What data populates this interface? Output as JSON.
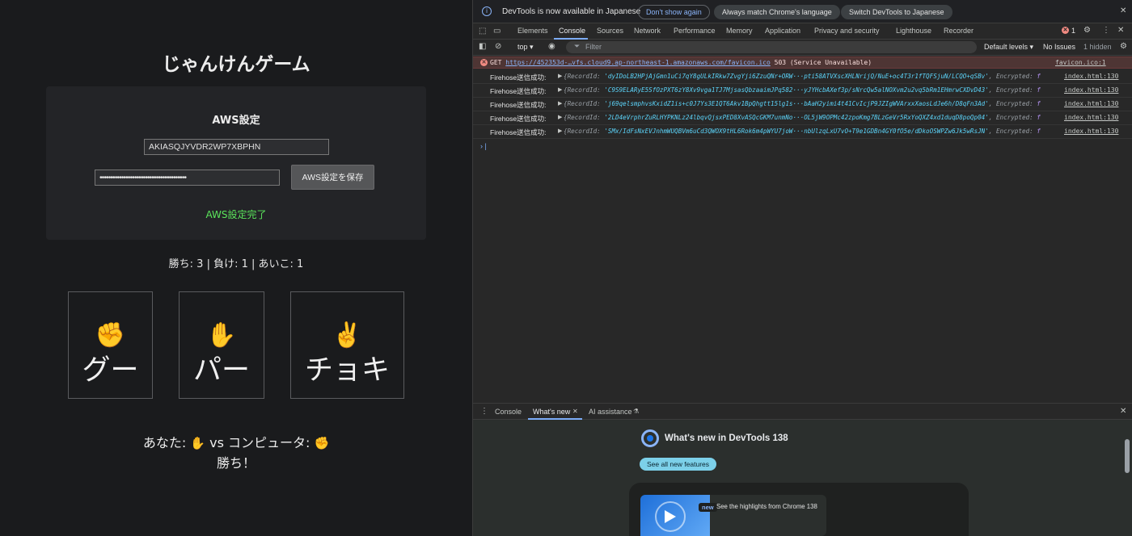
{
  "game": {
    "title": "じゃんけんゲーム",
    "aws_section_title": "AWS設定",
    "access_key_value": "AKIASQJYVDR2WP7XBPHN",
    "secret_key_masked": "••••••••••••••••••••••••••••••••••••••••",
    "save_button": "AWS設定を保存",
    "status_message": "AWS設定完了",
    "score": "勝ち: 3 | 負け: 1 | あいこ: 1",
    "choices": [
      {
        "emoji": "✊",
        "label": "グー"
      },
      {
        "emoji": "✋",
        "label": "パー"
      },
      {
        "emoji": "✌️",
        "label": "チョキ"
      }
    ],
    "result_prefix": "あなた:",
    "result_you_emoji": "✋",
    "result_vs": "vs コンピュータ:",
    "result_cpu_emoji": "✊",
    "result_outcome": "勝ち！"
  },
  "devtools": {
    "infobar": {
      "text": "DevTools is now available in Japanese",
      "btn_dont_show": "Don't show again",
      "btn_match": "Always match Chrome's language",
      "btn_switch": "Switch DevTools to Japanese"
    },
    "tabs": [
      "Elements",
      "Console",
      "Sources",
      "Network",
      "Performance",
      "Memory",
      "Application",
      "Privacy and security",
      "Lighthouse",
      "Recorder"
    ],
    "error_count": "1",
    "toolbar": {
      "context": "top ▾",
      "filter_placeholder": "Filter",
      "levels": "Default levels ▾",
      "issues": "No Issues",
      "hidden": "1 hidden"
    },
    "error_line": {
      "method": "GET",
      "url": "https://452353d-…vfs.cloud9.ap-northeast-1.amazonaws.com/favicon.ico",
      "status": "503 (Service Unavailable)",
      "source": "favicon.ico:1"
    },
    "logs": [
      {
        "label": "Firehose送信成功:",
        "record_id": "'dyIDoLB2HPjAjGmn1uCi7qY8gULkIRkw7ZvgYji6ZzuQNr+ORW···pti58ATVXscXHLNrijQ/NuE+oc4T3r1fTQFSjuN/LCQO+qSBv'",
        "encrypted": "false",
        "source": "index.html:130"
      },
      {
        "label": "Firehose送信成功:",
        "record_id": "'C9S9ELARyE5SfOzPXT6zY8Xv9vga1TJ7MjsasQbzaaimJPq582···yJYHcbAXef3p/sNrcQw5alNOXvm2u2vq5bRm1EHmrwCXDvD43'",
        "encrypted": "false",
        "source": "index.html:130"
      },
      {
        "label": "Firehose送信成功:",
        "record_id": "'j69qelsmphvsKxidZ1is+c0J7Ys3E1QT6Akv1BpQhgtt15lg1s···bAaH2yimi4t41CvIcjP9JZIgWVArxxXaosLdJe6h/D8qFn3Ad'",
        "encrypted": "false",
        "source": "index.html:130"
      },
      {
        "label": "Firehose送信成功:",
        "record_id": "'2LD4eVrphrZuRLHYPKNLz24lbqvQjsxPED8XvASQcGKM7unmNo···OL5jW9OPMc42zpoKmg7BLzGeVr5RxYoQXZ4xd1duqD8poQp04'",
        "encrypted": "false",
        "source": "index.html:130"
      },
      {
        "label": "Firehose送信成功:",
        "record_id": "'SMx/IdFsNxEVJnhmWUQBVm6uCd3QWOX9tHL6Rok6m4pWYU7joW···nbUlzqLxU7vO+T9e1GDBn4GY0fO5e/dDkoOSWPZw6Jk5wRsJN'",
        "encrypted": "false",
        "source": "index.html:130"
      }
    ],
    "log_key_record": "RecordId",
    "log_key_encrypted": "Encrypted",
    "drawer_tabs": [
      "Console",
      "What's new",
      "AI assistance"
    ],
    "whats_new": {
      "title": "What's new in DevTools 138",
      "button": "See all new features",
      "badge": "new",
      "highlight": "See the highlights from Chrome 138"
    }
  }
}
